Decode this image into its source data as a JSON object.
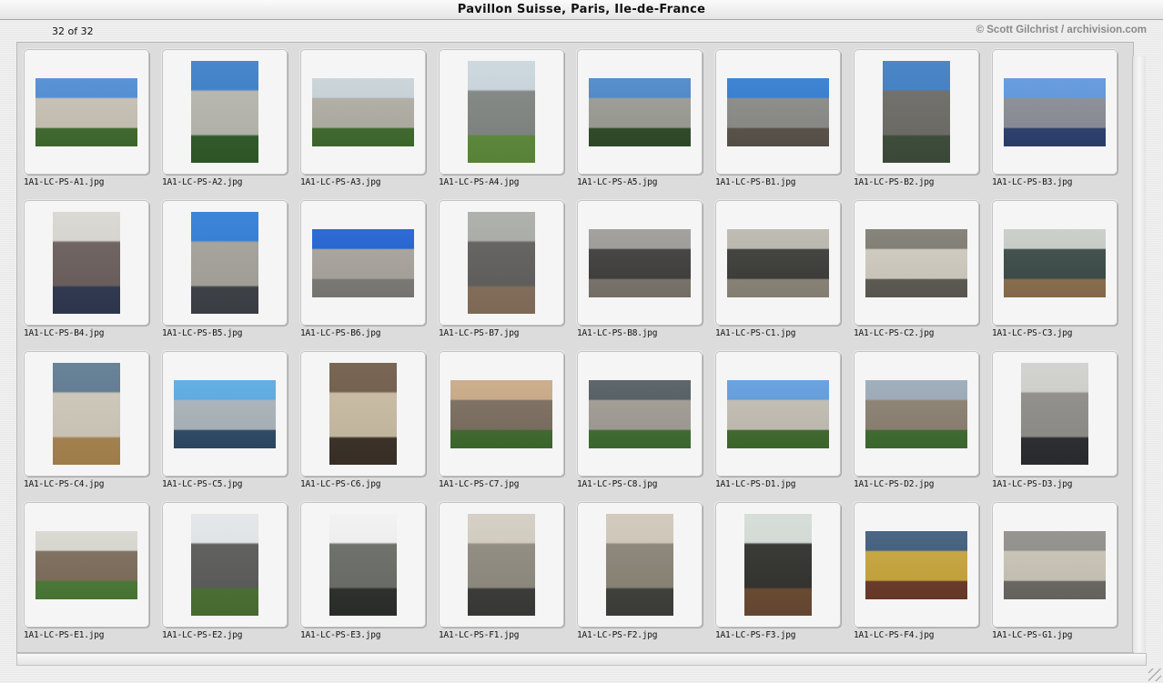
{
  "window": {
    "title": "Pavillon Suisse, Paris, Ile-de-France"
  },
  "header": {
    "counter": "32 of 32",
    "credit": "© Scott Gilchrist / archivision.com"
  },
  "thumbnails": [
    {
      "name": "1A1-LC-PS-A1.jpg",
      "orientation": "landscape",
      "colors": [
        "#4d8bd2",
        "#c8c2b5",
        "#3f6a2e"
      ]
    },
    {
      "name": "1A1-LC-PS-A2.jpg",
      "orientation": "portrait",
      "colors": [
        "#3a7dc8",
        "#b8b7ae",
        "#2f5a28"
      ]
    },
    {
      "name": "1A1-LC-PS-A3.jpg",
      "orientation": "landscape",
      "colors": [
        "#c7d2d8",
        "#b0aea4",
        "#3f6a2e"
      ]
    },
    {
      "name": "1A1-LC-PS-A4.jpg",
      "orientation": "portrait",
      "colors": [
        "#c9d6dc",
        "#808582",
        "#5d8a3a"
      ]
    },
    {
      "name": "1A1-LC-PS-A5.jpg",
      "orientation": "landscape",
      "colors": [
        "#4a86c9",
        "#9a9c94",
        "#2f4a28"
      ]
    },
    {
      "name": "1A1-LC-PS-B1.jpg",
      "orientation": "landscape",
      "colors": [
        "#2f7bd0",
        "#8a8b86",
        "#59524a"
      ]
    },
    {
      "name": "1A1-LC-PS-B2.jpg",
      "orientation": "portrait",
      "colors": [
        "#3c7cc4",
        "#6d6b66",
        "#3d4d3a"
      ]
    },
    {
      "name": "1A1-LC-PS-B3.jpg",
      "orientation": "landscape",
      "colors": [
        "#5c95dc",
        "#8a8d96",
        "#2c3f6e"
      ]
    },
    {
      "name": "1A1-LC-PS-B4.jpg",
      "orientation": "portrait",
      "colors": [
        "#d8d6d0",
        "#6a5e5c",
        "#2f3850"
      ]
    },
    {
      "name": "1A1-LC-PS-B5.jpg",
      "orientation": "portrait",
      "colors": [
        "#2d7bd6",
        "#a4a29a",
        "#3d4046"
      ]
    },
    {
      "name": "1A1-LC-PS-B6.jpg",
      "orientation": "landscape",
      "colors": [
        "#1d5fd0",
        "#a8a49c",
        "#7c7b78"
      ]
    },
    {
      "name": "1A1-LC-PS-B7.jpg",
      "orientation": "portrait",
      "colors": [
        "#a9aba6",
        "#5f5e5c",
        "#856f5b"
      ]
    },
    {
      "name": "1A1-LC-PS-B8.jpg",
      "orientation": "landscape",
      "colors": [
        "#9b9a96",
        "#3e3d3c",
        "#7a746c"
      ]
    },
    {
      "name": "1A1-LC-PS-C1.jpg",
      "orientation": "landscape",
      "colors": [
        "#b9b7ad",
        "#3b3b38",
        "#8a8577"
      ]
    },
    {
      "name": "1A1-LC-PS-C2.jpg",
      "orientation": "landscape",
      "colors": [
        "#7d7a70",
        "#cfcbc0",
        "#5c5a52"
      ]
    },
    {
      "name": "1A1-LC-PS-C3.jpg",
      "orientation": "landscape",
      "colors": [
        "#c7ccc6",
        "#3a4a46",
        "#8b6e4e"
      ]
    },
    {
      "name": "1A1-LC-PS-C4.jpg",
      "orientation": "portrait",
      "colors": [
        "#5c7890",
        "#cfc8ba",
        "#a8844e"
      ]
    },
    {
      "name": "1A1-LC-PS-C5.jpg",
      "orientation": "landscape",
      "colors": [
        "#58a9e2",
        "#aab4ba",
        "#2c4a66"
      ]
    },
    {
      "name": "1A1-LC-PS-C6.jpg",
      "orientation": "portrait",
      "colors": [
        "#6e5a46",
        "#c9bba2",
        "#3a3028"
      ]
    },
    {
      "name": "1A1-LC-PS-C7.jpg",
      "orientation": "landscape",
      "colors": [
        "#c8a884",
        "#7a6d5e",
        "#3f6a2e"
      ]
    },
    {
      "name": "1A1-LC-PS-C8.jpg",
      "orientation": "landscape",
      "colors": [
        "#4f5a60",
        "#a09c94",
        "#3e6c30"
      ]
    },
    {
      "name": "1A1-LC-PS-D1.jpg",
      "orientation": "landscape",
      "colors": [
        "#5f9bde",
        "#c3beb2",
        "#3f6a2e"
      ]
    },
    {
      "name": "1A1-LC-PS-D2.jpg",
      "orientation": "landscape",
      "colors": [
        "#9aa9b8",
        "#8b8070",
        "#3e6c30"
      ]
    },
    {
      "name": "1A1-LC-PS-D3.jpg",
      "orientation": "portrait",
      "colors": [
        "#cfcfcc",
        "#8f8d88",
        "#2a2c30"
      ]
    },
    {
      "name": "1A1-LC-PS-E1.jpg",
      "orientation": "landscape",
      "colors": [
        "#d8d6cf",
        "#7c6c5a",
        "#4a7a36"
      ]
    },
    {
      "name": "1A1-LC-PS-E2.jpg",
      "orientation": "portrait",
      "colors": [
        "#e2e6e8",
        "#5a5a58",
        "#4a7032"
      ]
    },
    {
      "name": "1A1-LC-PS-E3.jpg",
      "orientation": "portrait",
      "colors": [
        "#f0f1f0",
        "#6a6c66",
        "#2c2e2c"
      ]
    },
    {
      "name": "1A1-LC-PS-F1.jpg",
      "orientation": "portrait",
      "colors": [
        "#d2ccc0",
        "#8f8a7e",
        "#3a3a38"
      ]
    },
    {
      "name": "1A1-LC-PS-F2.jpg",
      "orientation": "portrait",
      "colors": [
        "#cfc7b8",
        "#8a8476",
        "#3e3e3a"
      ]
    },
    {
      "name": "1A1-LC-PS-F3.jpg",
      "orientation": "portrait",
      "colors": [
        "#d4dcd6",
        "#30302c",
        "#6a4a32"
      ]
    },
    {
      "name": "1A1-LC-PS-F4.jpg",
      "orientation": "landscape",
      "colors": [
        "#3c5a7a",
        "#c8a53a",
        "#6a3a28"
      ]
    },
    {
      "name": "1A1-LC-PS-G1.jpg",
      "orientation": "landscape",
      "colors": [
        "#8f8d88",
        "#c9c4b6",
        "#6a6862"
      ]
    }
  ]
}
